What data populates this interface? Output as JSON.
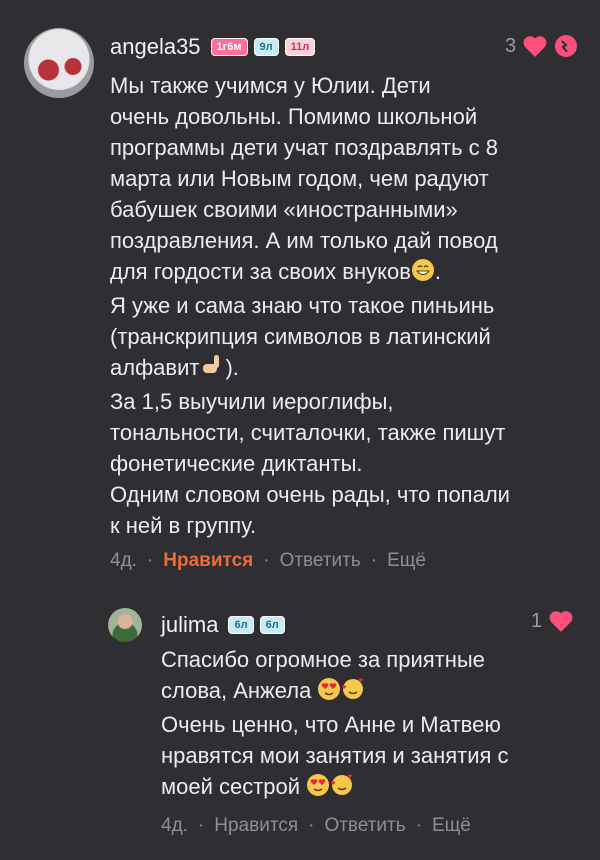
{
  "comments": [
    {
      "username": "angela35",
      "badges": [
        "1г6м",
        "9л",
        "11л"
      ],
      "like_count": "3",
      "text": "Мы также учимся у Юлии. Дети\nочень довольны. Помимо школьной\nпрограммы дети учат поздравлять с 8\nмарта или Новым годом, чем радуют\nбабушек своими «иностранными»\nпоздравления. А им только дай повод\nдля гордости за своих внуков",
      "text_2": ".\nЯ уже и сама знаю что такое пиньинь\n(транскрипция символов в латинский\nалфавит",
      "text_3": ").\nЗа 1,5 выучили иероглифы,\nтональности, считалочки, также пишут\nфонетические диктанты.\nОдним словом очень рады, что попали\nк ней в группу.",
      "time": "4д.",
      "like_label": "Нравится",
      "reply_label": "Ответить",
      "more_label": "Ещё"
    },
    {
      "username": "julima",
      "badges": [
        "6л",
        "6л"
      ],
      "like_count": "1",
      "text_1": "Спасибо огромное за приятные\nслова, Анжела",
      "text_2": "\nОчень ценно, что Анне и Матвею\nнравятся мои занятия и занятия с\nмоей сестрой",
      "time": "4д.",
      "like_label": "Нравится",
      "reply_label": "Ответить",
      "more_label": "Ещё"
    }
  ],
  "colors": {
    "background": "#2e2e33",
    "accent_like": "#f06a3a",
    "heart": "#ff4f7a"
  },
  "icons": [
    "heart-icon",
    "broken-heart-icon",
    "grin-emoji",
    "pointing-hand-emoji",
    "heart-eyes-emoji",
    "smiling-hearts-emoji"
  ]
}
